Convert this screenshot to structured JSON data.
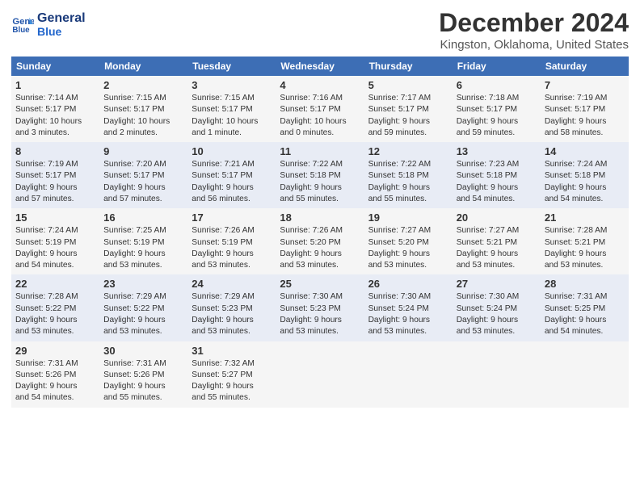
{
  "logo": {
    "line1": "General",
    "line2": "Blue"
  },
  "title": "December 2024",
  "subtitle": "Kingston, Oklahoma, United States",
  "days_header": [
    "Sunday",
    "Monday",
    "Tuesday",
    "Wednesday",
    "Thursday",
    "Friday",
    "Saturday"
  ],
  "weeks": [
    [
      {
        "day": "1",
        "info": "Sunrise: 7:14 AM\nSunset: 5:17 PM\nDaylight: 10 hours\nand 3 minutes."
      },
      {
        "day": "2",
        "info": "Sunrise: 7:15 AM\nSunset: 5:17 PM\nDaylight: 10 hours\nand 2 minutes."
      },
      {
        "day": "3",
        "info": "Sunrise: 7:15 AM\nSunset: 5:17 PM\nDaylight: 10 hours\nand 1 minute."
      },
      {
        "day": "4",
        "info": "Sunrise: 7:16 AM\nSunset: 5:17 PM\nDaylight: 10 hours\nand 0 minutes."
      },
      {
        "day": "5",
        "info": "Sunrise: 7:17 AM\nSunset: 5:17 PM\nDaylight: 9 hours\nand 59 minutes."
      },
      {
        "day": "6",
        "info": "Sunrise: 7:18 AM\nSunset: 5:17 PM\nDaylight: 9 hours\nand 59 minutes."
      },
      {
        "day": "7",
        "info": "Sunrise: 7:19 AM\nSunset: 5:17 PM\nDaylight: 9 hours\nand 58 minutes."
      }
    ],
    [
      {
        "day": "8",
        "info": "Sunrise: 7:19 AM\nSunset: 5:17 PM\nDaylight: 9 hours\nand 57 minutes."
      },
      {
        "day": "9",
        "info": "Sunrise: 7:20 AM\nSunset: 5:17 PM\nDaylight: 9 hours\nand 57 minutes."
      },
      {
        "day": "10",
        "info": "Sunrise: 7:21 AM\nSunset: 5:17 PM\nDaylight: 9 hours\nand 56 minutes."
      },
      {
        "day": "11",
        "info": "Sunrise: 7:22 AM\nSunset: 5:18 PM\nDaylight: 9 hours\nand 55 minutes."
      },
      {
        "day": "12",
        "info": "Sunrise: 7:22 AM\nSunset: 5:18 PM\nDaylight: 9 hours\nand 55 minutes."
      },
      {
        "day": "13",
        "info": "Sunrise: 7:23 AM\nSunset: 5:18 PM\nDaylight: 9 hours\nand 54 minutes."
      },
      {
        "day": "14",
        "info": "Sunrise: 7:24 AM\nSunset: 5:18 PM\nDaylight: 9 hours\nand 54 minutes."
      }
    ],
    [
      {
        "day": "15",
        "info": "Sunrise: 7:24 AM\nSunset: 5:19 PM\nDaylight: 9 hours\nand 54 minutes."
      },
      {
        "day": "16",
        "info": "Sunrise: 7:25 AM\nSunset: 5:19 PM\nDaylight: 9 hours\nand 53 minutes."
      },
      {
        "day": "17",
        "info": "Sunrise: 7:26 AM\nSunset: 5:19 PM\nDaylight: 9 hours\nand 53 minutes."
      },
      {
        "day": "18",
        "info": "Sunrise: 7:26 AM\nSunset: 5:20 PM\nDaylight: 9 hours\nand 53 minutes."
      },
      {
        "day": "19",
        "info": "Sunrise: 7:27 AM\nSunset: 5:20 PM\nDaylight: 9 hours\nand 53 minutes."
      },
      {
        "day": "20",
        "info": "Sunrise: 7:27 AM\nSunset: 5:21 PM\nDaylight: 9 hours\nand 53 minutes."
      },
      {
        "day": "21",
        "info": "Sunrise: 7:28 AM\nSunset: 5:21 PM\nDaylight: 9 hours\nand 53 minutes."
      }
    ],
    [
      {
        "day": "22",
        "info": "Sunrise: 7:28 AM\nSunset: 5:22 PM\nDaylight: 9 hours\nand 53 minutes."
      },
      {
        "day": "23",
        "info": "Sunrise: 7:29 AM\nSunset: 5:22 PM\nDaylight: 9 hours\nand 53 minutes."
      },
      {
        "day": "24",
        "info": "Sunrise: 7:29 AM\nSunset: 5:23 PM\nDaylight: 9 hours\nand 53 minutes."
      },
      {
        "day": "25",
        "info": "Sunrise: 7:30 AM\nSunset: 5:23 PM\nDaylight: 9 hours\nand 53 minutes."
      },
      {
        "day": "26",
        "info": "Sunrise: 7:30 AM\nSunset: 5:24 PM\nDaylight: 9 hours\nand 53 minutes."
      },
      {
        "day": "27",
        "info": "Sunrise: 7:30 AM\nSunset: 5:24 PM\nDaylight: 9 hours\nand 53 minutes."
      },
      {
        "day": "28",
        "info": "Sunrise: 7:31 AM\nSunset: 5:25 PM\nDaylight: 9 hours\nand 54 minutes."
      }
    ],
    [
      {
        "day": "29",
        "info": "Sunrise: 7:31 AM\nSunset: 5:26 PM\nDaylight: 9 hours\nand 54 minutes."
      },
      {
        "day": "30",
        "info": "Sunrise: 7:31 AM\nSunset: 5:26 PM\nDaylight: 9 hours\nand 55 minutes."
      },
      {
        "day": "31",
        "info": "Sunrise: 7:32 AM\nSunset: 5:27 PM\nDaylight: 9 hours\nand 55 minutes."
      },
      null,
      null,
      null,
      null
    ]
  ]
}
